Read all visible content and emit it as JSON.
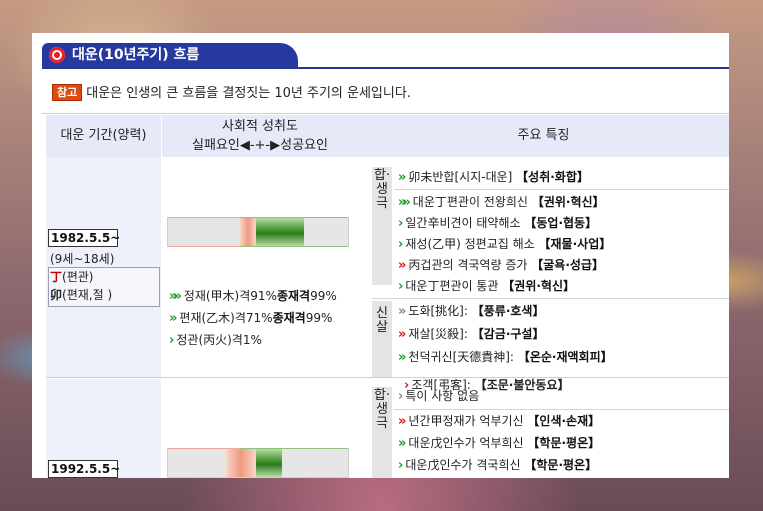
{
  "title": "대운(10년주기) 흐름",
  "note": {
    "badge": "참고",
    "text": "대운은 인생의 큰 흐름을 결정짓는 10년 주기의 운세입니다."
  },
  "headers": {
    "period": "대운 기간(양력)",
    "social_line1": "사회적 성취도",
    "social_line2": "실패요인◀-+-▶성공요인",
    "features": "주요 특징"
  },
  "rows": [
    {
      "date": "1982.5.5~",
      "age": "(9세~18세)",
      "ganji": [
        {
          "char": "丁",
          "desc": "(편관)"
        },
        {
          "char": "卯",
          "desc": "(편재,절 )"
        }
      ],
      "social": [
        {
          "arrow": "»»",
          "text": "정재(甲木)격91%",
          "bold": "종재격",
          "pct": "99%"
        },
        {
          "arrow": "»",
          "text": "편재(乙木)격71%",
          "bold": "종재격",
          "pct": "99%"
        },
        {
          "arrow": "›",
          "text": "정관(丙火)격1%",
          "bold": "",
          "pct": ""
        }
      ],
      "groups": [
        {
          "label": "합·생극",
          "lines": [
            {
              "arrow": "»",
              "text": "卯未반합[시지-대운]",
              "tag": "【성취·화합】"
            },
            {
              "arrow": "»»",
              "text": "대운丁편관이 전왕희신",
              "tag": "【권위·혁신】"
            },
            {
              "arrow": "›",
              "text": "일간辛비견이 태약해소",
              "tag": "【동업·협동】"
            },
            {
              "arrow": "›",
              "text": "재성(乙甲) 정편교집 해소",
              "tag": "【재물·사업】"
            },
            {
              "arrow": "»",
              "text": "丙겁관의 격국역량 증가",
              "tag": "【굴욕·성급】"
            },
            {
              "arrow": "›",
              "text": "대운丁편관이 통관",
              "tag": "【권위·혁신】"
            }
          ]
        },
        {
          "label": "신살",
          "lines": [
            {
              "arrow": "»",
              "text": "도화[挑化]:",
              "tag": "【풍류·호색】"
            },
            {
              "arrow": "»",
              "text": "재살[災殺]:",
              "tag": "【감금·구설】"
            },
            {
              "arrow": "»",
              "text": "천덕귀신[天德貴神]:",
              "tag": "【온순·재액회피】"
            },
            {
              "arrow": "›",
              "text": "조객[弔客]:",
              "tag": "【조문·불안동요】"
            }
          ]
        }
      ]
    },
    {
      "date": "1992.5.5~",
      "groups": [
        {
          "label": "합·생극",
          "lines": [
            {
              "arrow": "›",
              "text": "특이 사항 없음",
              "tag": ""
            },
            {
              "arrow": "»",
              "text": "년간甲정재가 억부기신",
              "tag": "【인색·손재】"
            },
            {
              "arrow": "»",
              "text": "대운戊인수가 억부희신",
              "tag": "【학문·평온】"
            },
            {
              "arrow": "›",
              "text": "대운戊인수가 격국희신",
              "tag": "【학문·평온】"
            }
          ]
        }
      ]
    }
  ]
}
